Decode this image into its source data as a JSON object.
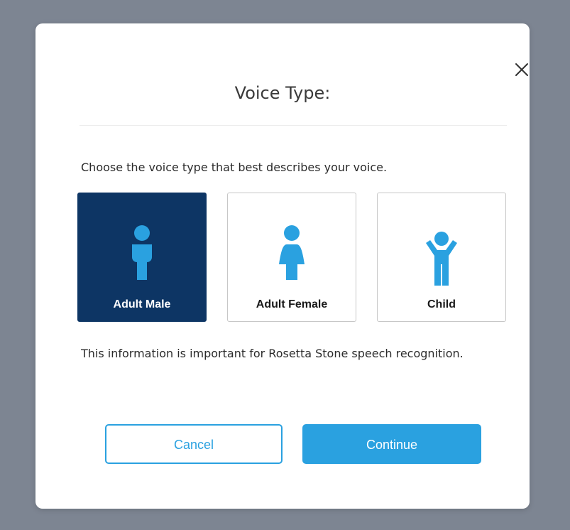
{
  "dialog": {
    "title": "Voice Type:",
    "instructions": "Choose the voice type that best describes your voice.",
    "info": "This information is important for Rosetta Stone speech recognition.",
    "close_icon": "close-icon"
  },
  "options": [
    {
      "label": "Adult Male",
      "icon": "adult-male-icon",
      "selected": true
    },
    {
      "label": "Adult Female",
      "icon": "adult-female-icon",
      "selected": false
    },
    {
      "label": "Child",
      "icon": "child-icon",
      "selected": false
    }
  ],
  "buttons": {
    "cancel_label": "Cancel",
    "continue_label": "Continue"
  },
  "colors": {
    "backdrop": "#7d8592",
    "selected_background": "#0d3564",
    "accent": "#2aa1e0",
    "icon": "#2aa1e0"
  }
}
